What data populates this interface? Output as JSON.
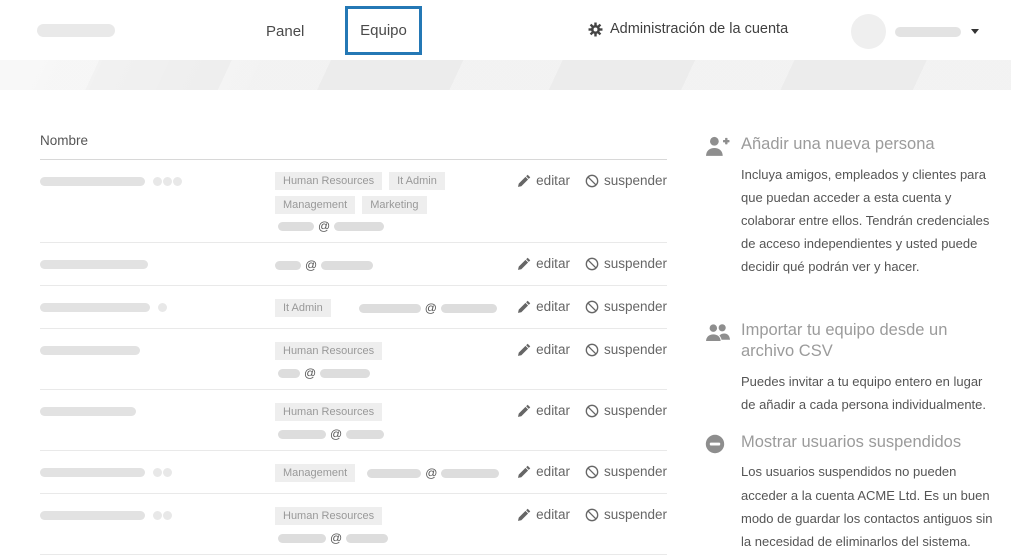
{
  "header": {
    "nav_panel_label": "Panel",
    "nav_equipo_label": "Equipo",
    "account_admin_label": "Administración de la cuenta"
  },
  "table": {
    "header": "Nombre",
    "actions": {
      "edit_label": "editar",
      "suspend_label": "suspender"
    },
    "rows": [
      {
        "name_width": 105,
        "dots": 3,
        "tags": [
          "Human Resources",
          "It Admin",
          "Management",
          "Marketing"
        ],
        "email": {
          "position": "below",
          "w1": 36,
          "w2": 50
        }
      },
      {
        "name_width": 108,
        "dots": 0,
        "tags": [],
        "email": {
          "position": "inline",
          "w1": 26,
          "w2": 52,
          "indent": 0
        }
      },
      {
        "name_width": 110,
        "dots": 1,
        "tags": [
          "It Admin"
        ],
        "email": {
          "position": "inline",
          "w1": 62,
          "w2": 56,
          "indent": 28
        }
      },
      {
        "name_width": 100,
        "dots": 0,
        "tags": [
          "Human Resources"
        ],
        "email": {
          "position": "below",
          "w1": 22,
          "w2": 50
        }
      },
      {
        "name_width": 96,
        "dots": 0,
        "tags": [
          "Human Resources"
        ],
        "email": {
          "position": "below",
          "w1": 48,
          "w2": 38
        }
      },
      {
        "name_width": 105,
        "dots": 2,
        "tags": [
          "Management"
        ],
        "email": {
          "position": "inline",
          "w1": 54,
          "w2": 58,
          "indent": 12
        }
      },
      {
        "name_width": 105,
        "dots": 2,
        "tags": [
          "Human Resources"
        ],
        "email": {
          "position": "below",
          "w1": 48,
          "w2": 42
        }
      }
    ]
  },
  "sidebar": {
    "sections": [
      {
        "icon": "user-plus-icon",
        "title": "Añadir una nueva persona",
        "body": "Incluya amigos, empleados y clientes para que puedan acceder a esta cuenta y colaborar entre ellos. Tendrán credenciales de acceso independientes y usted puede decidir qué podrán ver y hacer."
      },
      {
        "icon": "users-icon",
        "title": "Importar tu equipo desde un archivo CSV",
        "body": "Puedes invitar a tu equipo entero en lugar de añadir a cada persona individualmente."
      },
      {
        "icon": "minus-circle-icon",
        "title": "Mostrar usuarios suspendidos",
        "body": "Los usuarios suspendidos no pueden acceder a la cuenta ACME Ltd. Es un buen modo de guardar los contactos antiguos sin la necesidad de eliminarlos del sistema."
      }
    ]
  },
  "colors": {
    "accent_blue": "#2478b5",
    "band_background": "#ececec",
    "tag_background": "#eeeeee",
    "tag_text": "#999999",
    "action_text": "#666666",
    "sidebar_title": "#9b9b9b",
    "body_text": "#555555"
  }
}
